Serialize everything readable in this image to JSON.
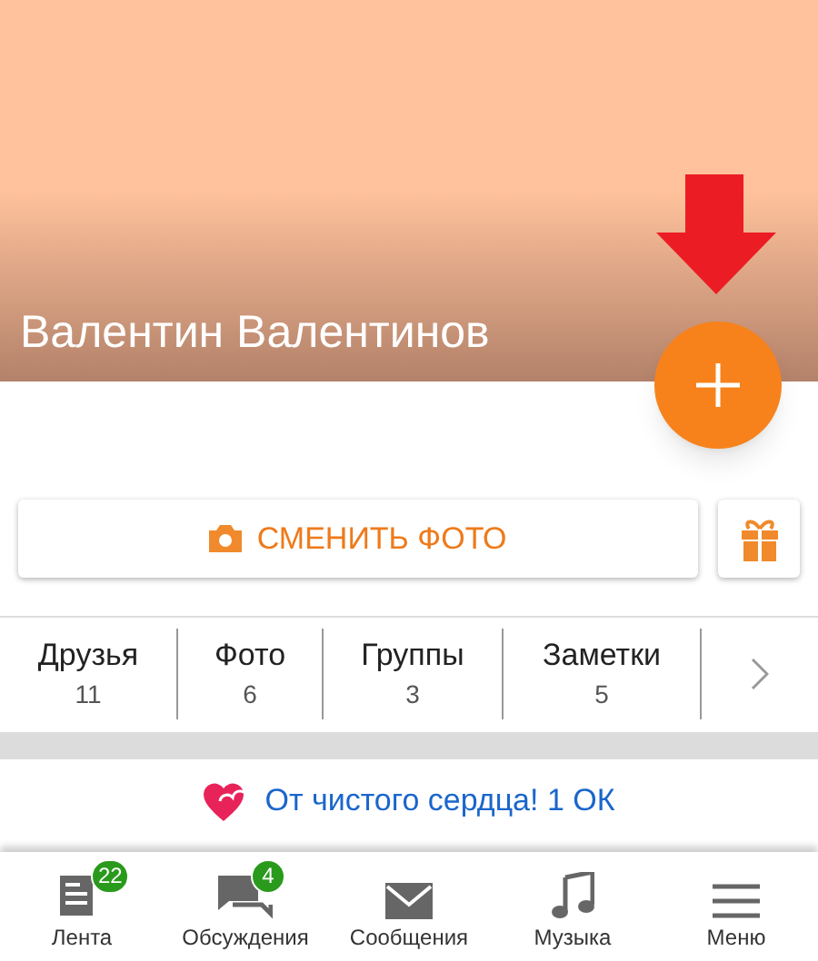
{
  "profile": {
    "name": "Валентин Валентинов"
  },
  "actions": {
    "change_photo": "СМЕНИТЬ ФОТО"
  },
  "stats": [
    {
      "label": "Друзья",
      "count": "11"
    },
    {
      "label": "Фото",
      "count": "6"
    },
    {
      "label": "Группы",
      "count": "3"
    },
    {
      "label": "Заметки",
      "count": "5"
    }
  ],
  "promo": {
    "text": "От чистого сердца! 1 ОК"
  },
  "bottom_nav": [
    {
      "kind": "feed",
      "label": "Лента",
      "badge": "22"
    },
    {
      "kind": "discussions",
      "label": "Обсуждения",
      "badge": "4"
    },
    {
      "kind": "messages",
      "label": "Сообщения"
    },
    {
      "kind": "music",
      "label": "Музыка"
    },
    {
      "kind": "menu",
      "label": "Меню"
    }
  ]
}
